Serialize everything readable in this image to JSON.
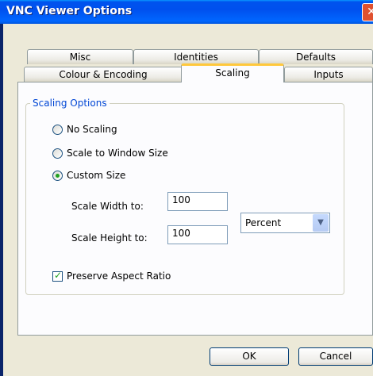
{
  "window": {
    "title": "VNC Viewer Options"
  },
  "tabs": {
    "row_back": [
      "Misc",
      "Identities",
      "Defaults"
    ],
    "row_front": [
      "Colour & Encoding",
      "Scaling",
      "Inputs"
    ],
    "active": "Scaling"
  },
  "scaling": {
    "group_label": "Scaling Options",
    "options": [
      "No Scaling",
      "Scale to Window Size",
      "Custom Size"
    ],
    "selected": "Custom Size",
    "width_label": "Scale Width to:",
    "width_value": "100",
    "height_label": "Scale Height to:",
    "height_value": "100",
    "unit_value": "Percent",
    "preserve_label": "Preserve Aspect Ratio",
    "preserve_checked": true
  },
  "buttons": {
    "ok": "OK",
    "cancel": "Cancel"
  }
}
